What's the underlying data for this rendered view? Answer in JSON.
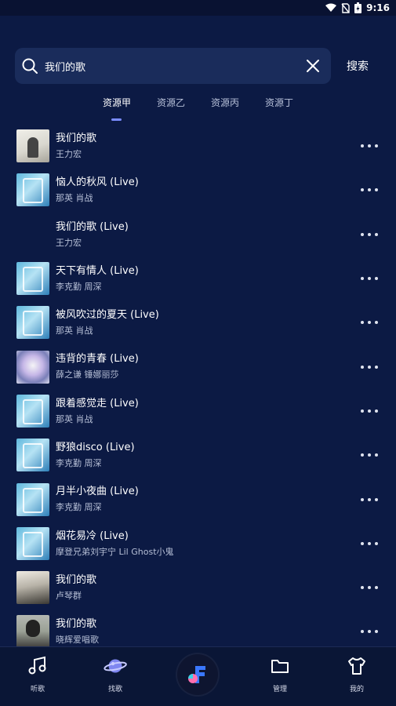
{
  "status_bar": {
    "time": "9:16"
  },
  "search": {
    "query": "我们的歌",
    "button_label": "搜索"
  },
  "tabs": [
    {
      "label": "资源甲",
      "active": true
    },
    {
      "label": "资源乙",
      "active": false
    },
    {
      "label": "资源丙",
      "active": false
    },
    {
      "label": "资源丁",
      "active": false
    }
  ],
  "songs": [
    {
      "title": "我们的歌",
      "artist": "王力宏",
      "cover": "portrait"
    },
    {
      "title": "恼人的秋风 (Live)",
      "artist": "那英  肖战",
      "cover": "show"
    },
    {
      "title": "我们的歌 (Live)",
      "artist": "王力宏",
      "cover": "none"
    },
    {
      "title": "天下有情人 (Live)",
      "artist": "李克勤  周深",
      "cover": "show"
    },
    {
      "title": "被风吹过的夏天 (Live)",
      "artist": "那英  肖战",
      "cover": "show"
    },
    {
      "title": "违背的青春 (Live)",
      "artist": "薛之谦  锤娜丽莎",
      "cover": "mix"
    },
    {
      "title": "跟着感觉走 (Live)",
      "artist": "那英  肖战",
      "cover": "show"
    },
    {
      "title": "野狼disco (Live)",
      "artist": "李克勤  周深",
      "cover": "show"
    },
    {
      "title": "月半小夜曲 (Live)",
      "artist": "李克勤  周深",
      "cover": "show"
    },
    {
      "title": "烟花易冷 (Live)",
      "artist": "摩登兄弟刘宇宁  Lil Ghost小鬼",
      "cover": "show"
    },
    {
      "title": "我们的歌",
      "artist": "卢琴群",
      "cover": "girl"
    },
    {
      "title": "我们的歌",
      "artist": "晓辉爱唱歌",
      "cover": "man"
    }
  ],
  "bottom_nav": {
    "listen": "听歌",
    "discover": "找歌",
    "manage": "管理",
    "mine": "我的"
  },
  "colors": {
    "background": "#0c1a44",
    "accent": "#7a8cff",
    "search_bg": "#1a2c5b"
  }
}
